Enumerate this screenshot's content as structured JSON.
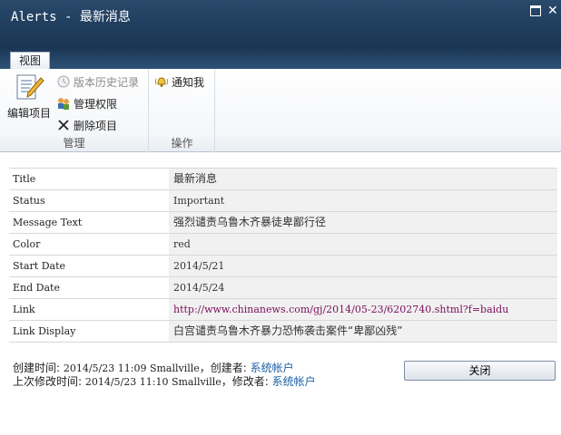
{
  "window": {
    "title": "Alerts - 最新消息",
    "icons": {
      "maximize": "maximize-icon",
      "close": "close-icon"
    }
  },
  "ribbon": {
    "tab_label": "视图",
    "manage_group": {
      "label": "管理",
      "edit_item": "编辑项目",
      "version_history": "版本历史记录",
      "manage_permissions": "管理权限",
      "delete_item": "删除项目"
    },
    "actions_group": {
      "label": "操作",
      "alert_me": "通知我"
    }
  },
  "fields": [
    {
      "label": "Title",
      "value": "最新消息"
    },
    {
      "label": "Status",
      "value": "Important"
    },
    {
      "label": "Message Text",
      "value": "强烈谴责乌鲁木齐暴徒卑鄙行径"
    },
    {
      "label": "Color",
      "value": "red"
    },
    {
      "label": "Start Date",
      "value": "2014/5/21"
    },
    {
      "label": "End Date",
      "value": "2014/5/24"
    },
    {
      "label": "Link",
      "value": "http://www.chinanews.com/gj/2014/05-23/6202740.shtml?f=baidu"
    },
    {
      "label": "Link Display",
      "value": "白宫谴责乌鲁木齐暴力恐怖袭击案件“卑鄙凶残”"
    }
  ],
  "footer": {
    "created_prefix": "创建时间: ",
    "created_time": "2014/5/23 11:09 Smallville",
    "created_by_prefix": "，创建者: ",
    "created_by": "系统帐户",
    "modified_prefix": "上次修改时间: ",
    "modified_time": "2014/5/23 11:10 Smallville",
    "modified_by_prefix": "，修改者: ",
    "modified_by": "系统帐户"
  },
  "buttons": {
    "close": "关闭"
  },
  "colors": {
    "titlebar": "#1f3c5c",
    "link": "#7b0e5a",
    "user_link": "#1a5fa8"
  }
}
